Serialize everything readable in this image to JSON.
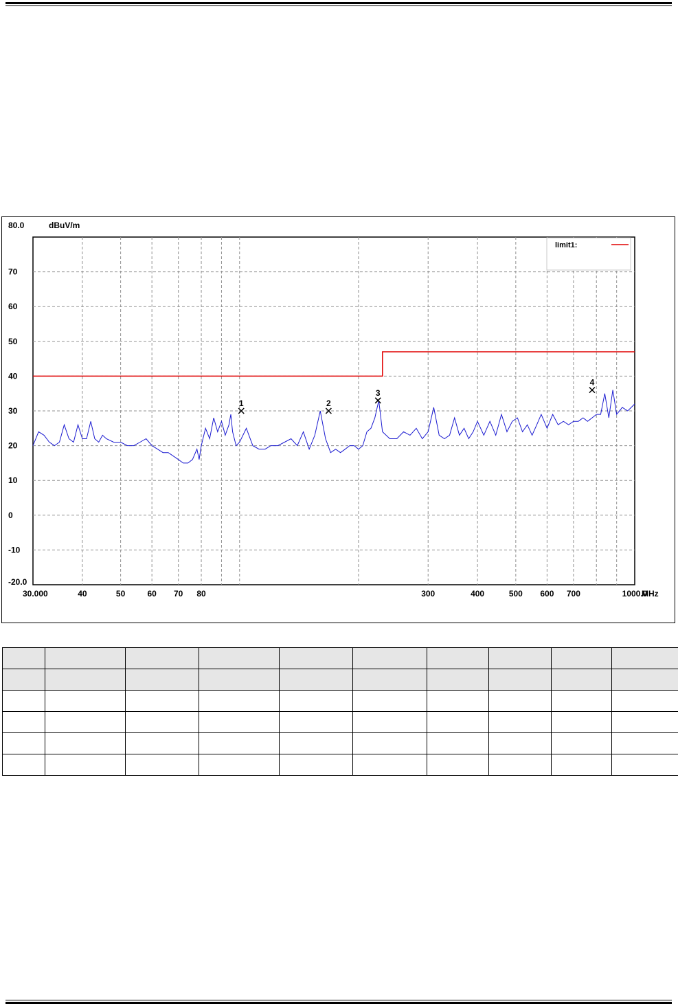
{
  "chart_data": {
    "type": "line",
    "x_scale": "log",
    "x_unit": "MHz",
    "y_unit": "dBuV/m",
    "xlim": [
      30,
      1000
    ],
    "ylim": [
      -20,
      80
    ],
    "y_ticks": [
      "80.0",
      "70",
      "60",
      "50",
      "40",
      "30",
      "20",
      "10",
      "0",
      "-10",
      "-20.0"
    ],
    "x_ticks": [
      {
        "value": 30,
        "label": "30.000"
      },
      {
        "value": 40,
        "label": "40"
      },
      {
        "value": 50,
        "label": "50"
      },
      {
        "value": 60,
        "label": "60"
      },
      {
        "value": 70,
        "label": "70"
      },
      {
        "value": 80,
        "label": "80"
      },
      {
        "value": 300,
        "label": "300"
      },
      {
        "value": 400,
        "label": "400"
      },
      {
        "value": 500,
        "label": "500"
      },
      {
        "value": 600,
        "label": "600"
      },
      {
        "value": 700,
        "label": "700"
      },
      {
        "value": 1000,
        "label": "1000.0"
      }
    ],
    "grid_x": [
      40,
      50,
      60,
      70,
      80,
      90,
      100,
      200,
      300,
      400,
      500,
      600,
      700,
      800,
      900
    ],
    "grid": true,
    "legend": {
      "label": "limit1:",
      "placement": "top-right"
    },
    "colors": {
      "trace": "#1a1ad0",
      "limit": "#e00000",
      "grid": "#909090"
    },
    "series": [
      {
        "name": "limit1",
        "x": [
          30,
          230,
          230,
          1000
        ],
        "y": [
          40,
          40,
          47,
          47
        ]
      },
      {
        "x": [
          30,
          31,
          32,
          33,
          34,
          35,
          36,
          37,
          38,
          39,
          40,
          41,
          42,
          43,
          44,
          45,
          46,
          48,
          50,
          52,
          54,
          56,
          58,
          60,
          62,
          64,
          66,
          68,
          70,
          72,
          74,
          76,
          78,
          79,
          80,
          82,
          84,
          86,
          88,
          90,
          92,
          94,
          95,
          96,
          98,
          100,
          104,
          108,
          112,
          116,
          120,
          125,
          130,
          135,
          140,
          145,
          150,
          155,
          160,
          165,
          170,
          175,
          180,
          185,
          190,
          195,
          200,
          205,
          210,
          215,
          220,
          225,
          230,
          240,
          250,
          260,
          270,
          280,
          290,
          300,
          310,
          320,
          330,
          340,
          350,
          360,
          370,
          380,
          390,
          400,
          415,
          430,
          445,
          460,
          475,
          490,
          505,
          520,
          535,
          550,
          565,
          580,
          600,
          620,
          640,
          660,
          680,
          700,
          720,
          740,
          760,
          780,
          800,
          820,
          840,
          860,
          880,
          900,
          930,
          960,
          1000
        ],
        "y": [
          20,
          24,
          23,
          21,
          20,
          21,
          26,
          22,
          21,
          26,
          22,
          22,
          27,
          22,
          21,
          23,
          22,
          21,
          21,
          20,
          20,
          21,
          22,
          20,
          19,
          18,
          18,
          17,
          16,
          15,
          15,
          16,
          19,
          16,
          20,
          25,
          22,
          28,
          24,
          27,
          23,
          26,
          29,
          24,
          20,
          21,
          25,
          20,
          19,
          19,
          20,
          20,
          21,
          22,
          20,
          24,
          19,
          23,
          30,
          22,
          18,
          19,
          18,
          19,
          20,
          20,
          19,
          20,
          24,
          25,
          28,
          33,
          24,
          22,
          22,
          24,
          23,
          25,
          22,
          24,
          31,
          23,
          22,
          23,
          28,
          23,
          25,
          22,
          24,
          27,
          23,
          27,
          23,
          29,
          24,
          27,
          28,
          24,
          26,
          23,
          26,
          29,
          25,
          29,
          26,
          27,
          26,
          27,
          27,
          28,
          27,
          28,
          29,
          29,
          35,
          28,
          36,
          29,
          31,
          30,
          32
        ]
      }
    ],
    "markers": [
      {
        "label": "1",
        "x": 101,
        "y": 30
      },
      {
        "label": "2",
        "x": 168,
        "y": 30
      },
      {
        "label": "3",
        "x": 224,
        "y": 33
      },
      {
        "label": "4",
        "x": 780,
        "y": 36
      }
    ]
  },
  "table": {
    "rows": 6,
    "cols": 10
  }
}
